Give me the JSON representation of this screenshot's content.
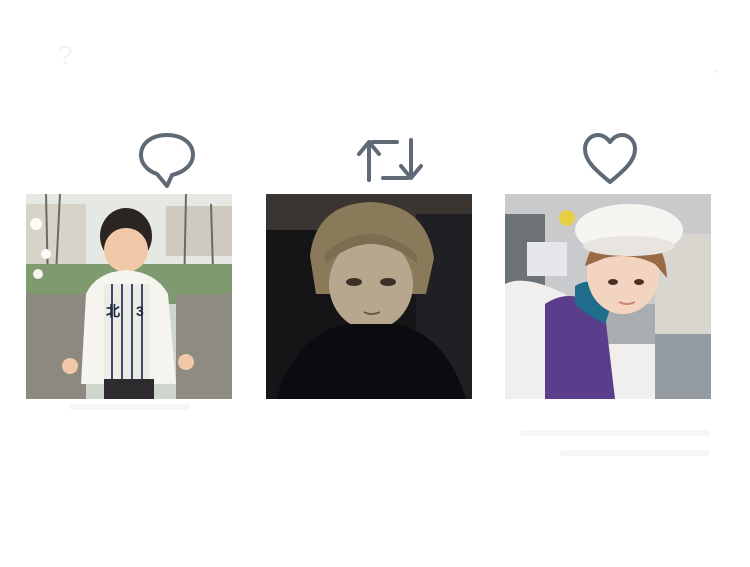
{
  "faint_text": {
    "top_left": "?"
  },
  "actions": [
    {
      "name": "reply",
      "icon": "speech-bubble-icon"
    },
    {
      "name": "retweet",
      "icon": "retweet-arrows-icon"
    },
    {
      "name": "like",
      "icon": "heart-outline-icon"
    }
  ],
  "colors": {
    "icon_stroke": "#5f6a76",
    "background": "#ffffff"
  },
  "photos": [
    {
      "subject": "photo-child-baseball-jacket"
    },
    {
      "subject": "photo-dark-hoodie"
    },
    {
      "subject": "photo-white-beret"
    }
  ]
}
